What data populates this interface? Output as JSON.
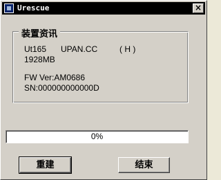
{
  "window": {
    "title": "Urescue",
    "close_glyph": "×"
  },
  "device_info": {
    "group_title": "装置资讯",
    "model": "Ut165",
    "vendor": "UPAN.CC",
    "drive": "( H )",
    "capacity": "1928MB",
    "fw_version": "FW Ver:AM0686",
    "serial": "SN:000000000000D"
  },
  "progress": {
    "percent": 0,
    "label": "0%"
  },
  "buttons": {
    "rebuild": "重建",
    "finish": "结束"
  },
  "colors": {
    "dialog_face": "#d4d0c8",
    "titlebar": "#000000",
    "progress_fill": "#0a246a"
  }
}
